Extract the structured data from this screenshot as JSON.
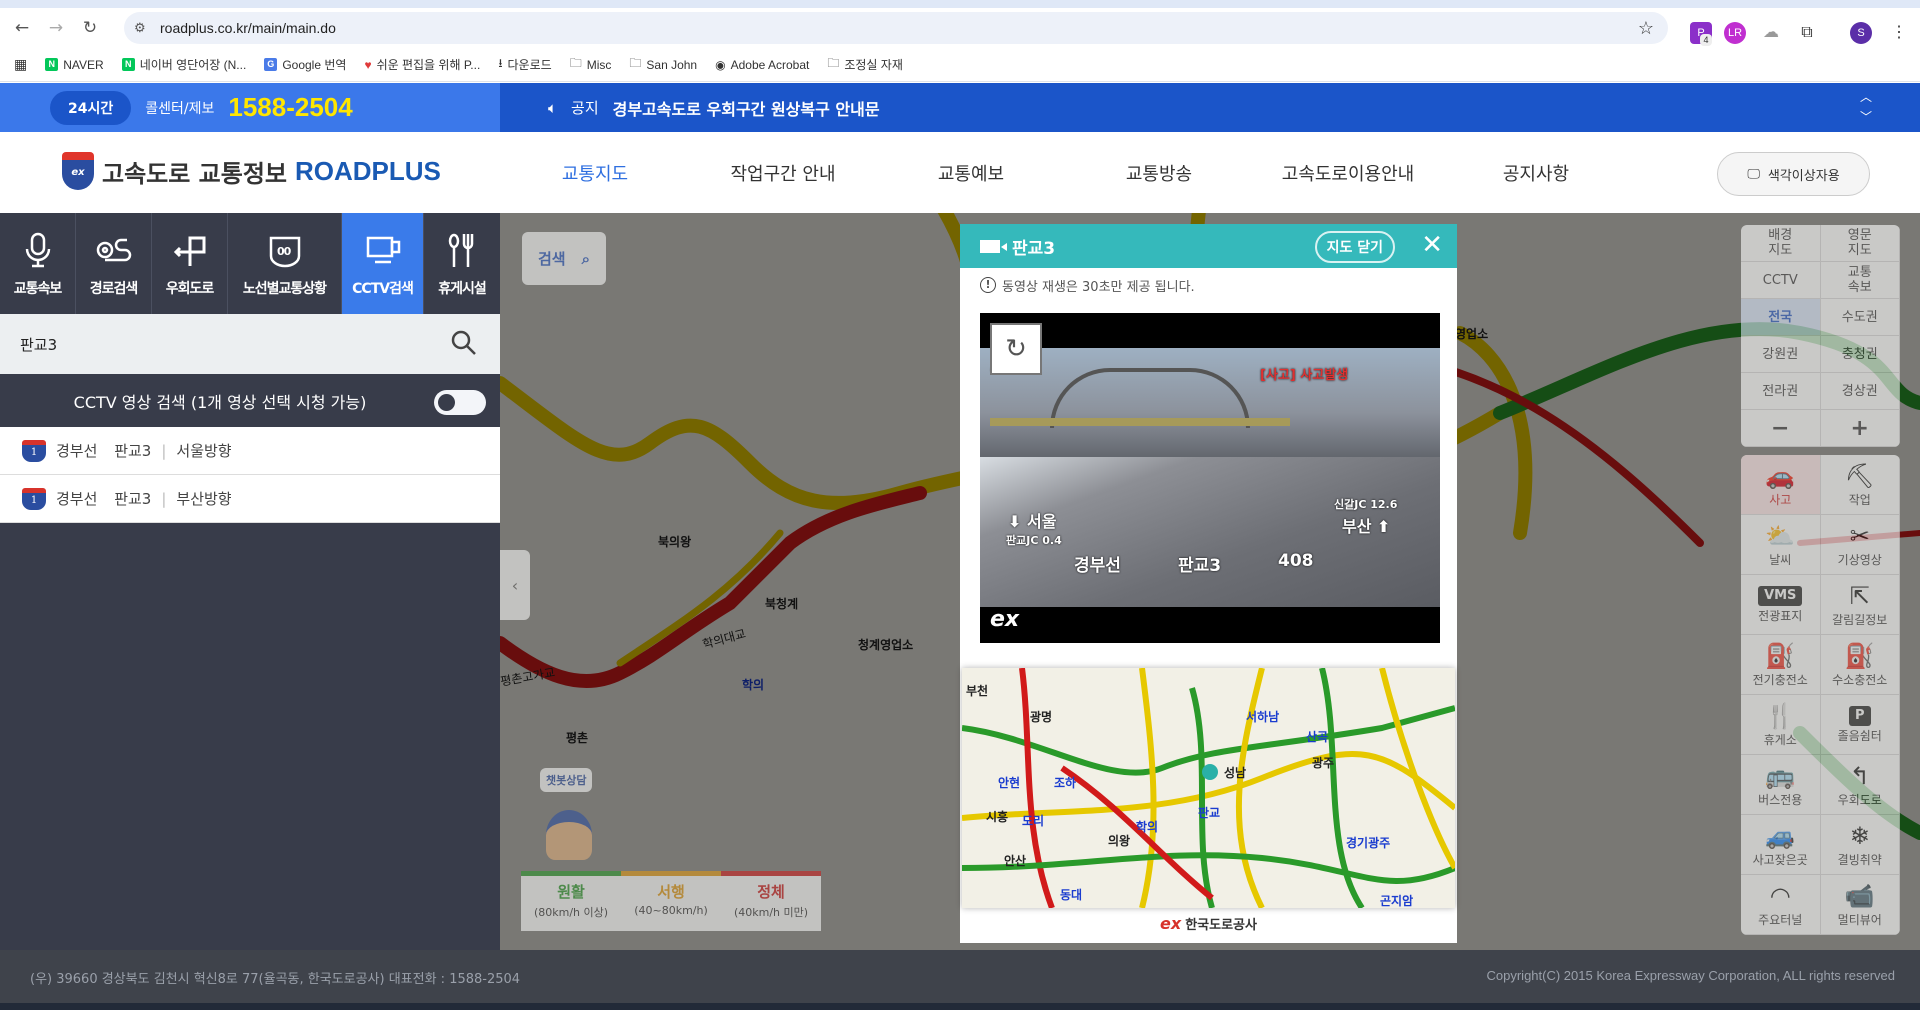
{
  "browser": {
    "url": "roadplus.co.kr/main/main.do",
    "ext_badge": "4",
    "profile": "S",
    "bookmarks": [
      "NAVER",
      "네이버 영단어장 (N...",
      "Google 번역",
      "쉬운 편집을 위해 P...",
      "다운로드",
      "Misc",
      "San John",
      "Adobe Acrobat",
      "조정실 자재"
    ]
  },
  "topbar": {
    "badge": "24시간",
    "call_label": "콜센터/제보",
    "phone": "1588-2504",
    "notice_label": "공지",
    "notice_text": "경부고속도로 우회구간 원상복구 안내문"
  },
  "header": {
    "logo_text": "고속도로 교통정보",
    "logo_brand": "ROADPLUS",
    "logo_mark": "ex",
    "nav": [
      "교통지도",
      "작업구간 안내",
      "교통예보",
      "교통방송",
      "고속도로이용안내",
      "공지사항"
    ],
    "colorblind": "색각이상자용"
  },
  "left": {
    "tabs": [
      "교통속보",
      "경로검색",
      "우회도로",
      "노선별교통상황",
      "CCTV검색",
      "휴게시설"
    ],
    "search_value": "판교3",
    "cctv_toggle_label": "CCTV 영상 검색 (1개 영상 선택 시청 가능)",
    "results": [
      {
        "route_no": "1",
        "route": "경부선",
        "name": "판교3",
        "dir": "서울방향"
      },
      {
        "route_no": "1",
        "route": "경부선",
        "name": "판교3",
        "dir": "부산방향"
      }
    ]
  },
  "map": {
    "search_label": "검색",
    "labels": [
      "북의왕",
      "북청계",
      "청계영업소",
      "학의",
      "학의대교",
      "평촌",
      "평촌고가교",
      "영업소"
    ],
    "chatbot": "챗봇상담",
    "legend": [
      {
        "name": "원활",
        "range": "(80km/h 이상)",
        "color": "#2a9a2a"
      },
      {
        "name": "서행",
        "range": "(40~80km/h)",
        "color": "#e59a10"
      },
      {
        "name": "정체",
        "range": "(40km/h 미만)",
        "color": "#d11a1a"
      }
    ]
  },
  "right_panel": {
    "top": [
      "배경\n지도",
      "영문\n지도",
      "CCTV",
      "교통\n속보",
      "전국",
      "수도권",
      "강원권",
      "충청권",
      "전라권",
      "경상권",
      "−",
      "+"
    ],
    "layers": [
      {
        "label": "사고",
        "icon": "🚗"
      },
      {
        "label": "작업",
        "icon": "⛏"
      },
      {
        "label": "날씨",
        "icon": "⛅"
      },
      {
        "label": "기상영상",
        "icon": "✂"
      },
      {
        "label": "전광표지",
        "icon": "VMS"
      },
      {
        "label": "갈림길정보",
        "icon": "⇱"
      },
      {
        "label": "전기충전소",
        "icon": "⛽"
      },
      {
        "label": "수소충전소",
        "icon": "⛽"
      },
      {
        "label": "휴게소",
        "icon": "🍴"
      },
      {
        "label": "졸음쉼터",
        "icon": "P"
      },
      {
        "label": "버스전용",
        "icon": "🚌"
      },
      {
        "label": "우회도로",
        "icon": "↰"
      },
      {
        "label": "사고잦은곳",
        "icon": "🚙"
      },
      {
        "label": "결빙취약",
        "icon": "❄"
      },
      {
        "label": "주요터널",
        "icon": "◠"
      },
      {
        "label": "멀티뷰어",
        "icon": "📹"
      }
    ]
  },
  "popup": {
    "title": "판교3",
    "close_map": "지도 닫기",
    "note": "동영상 재생은 30초만 제공 됩니다.",
    "video": {
      "alert": "[사고] 사고발생",
      "left_dir": "⬇ 서울",
      "left_sub": "판교JC 0.4",
      "right_sub": "신갈JC 12.6",
      "right_dir": "부산 ⬆",
      "caption_route": "경부선",
      "caption_name": "판교3",
      "caption_no": "408",
      "brand": "ex"
    },
    "dir_left": "서울",
    "dir_right": "부산",
    "minimap_labels": [
      "부천",
      "광명",
      "안현",
      "조하",
      "시흥",
      "도리",
      "안산",
      "의왕",
      "학의",
      "판교",
      "성남",
      "서하남",
      "산곡",
      "광주",
      "경기광주",
      "곤지암",
      "동대"
    ],
    "footer": "한국도로공사",
    "footer_mark": "ex"
  },
  "footer": {
    "address": "(우) 39660 경상북도 김천시 혁신8로 77(율곡동, 한국도로공사) 대표전화 : 1588-2504",
    "copyright": "Copyright(C) 2015 Korea Expressway Corporation, ALL rights reserved"
  }
}
